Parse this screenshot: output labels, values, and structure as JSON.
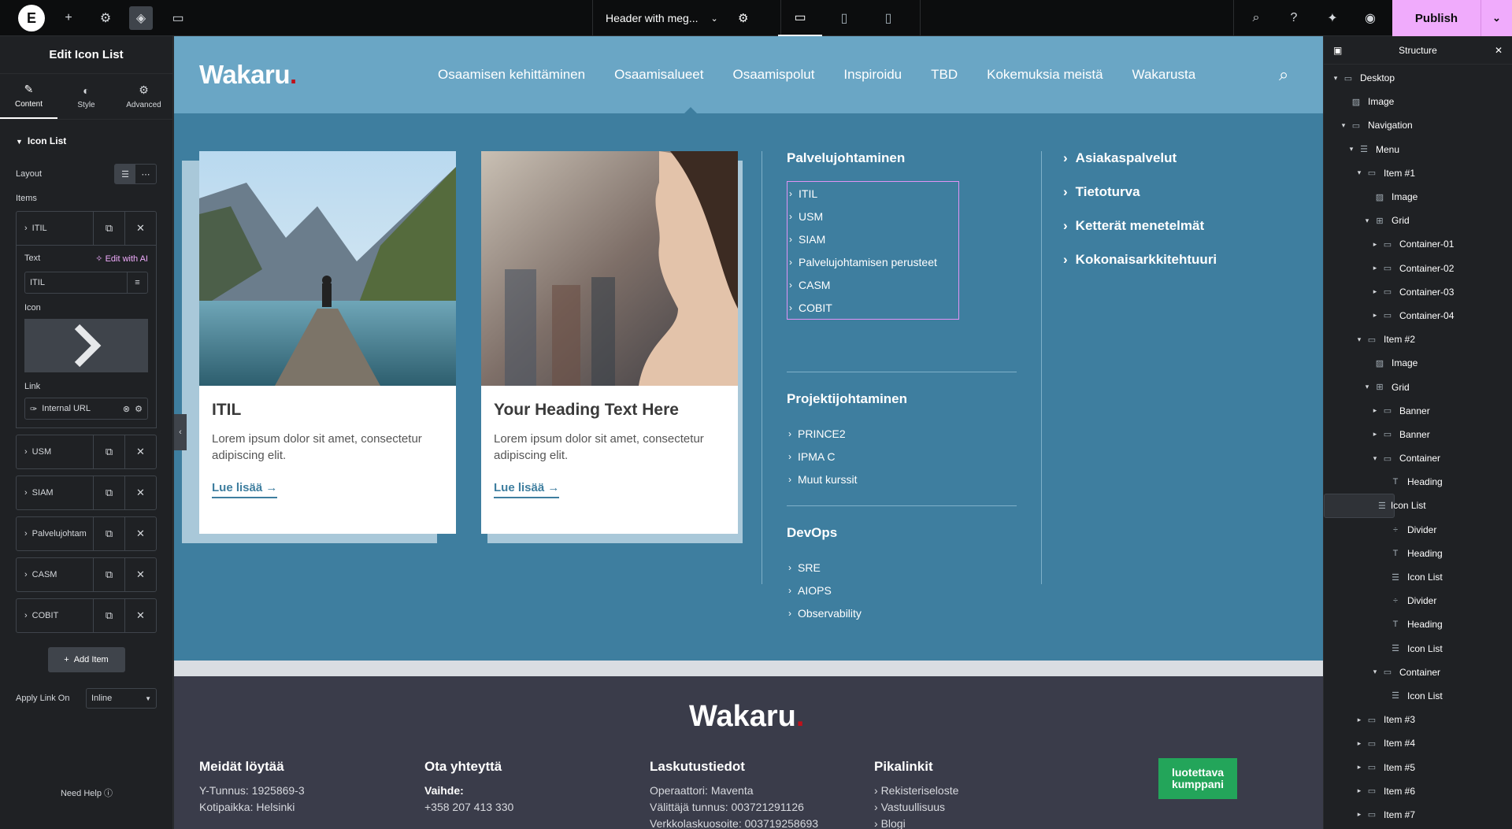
{
  "topbar": {
    "logo": "E",
    "doc_title": "Header with meg...",
    "publish": "Publish"
  },
  "panel": {
    "title": "Edit Icon List",
    "tabs": [
      {
        "label": "Content"
      },
      {
        "label": "Style"
      },
      {
        "label": "Advanced"
      }
    ],
    "section": "Icon List",
    "layout_label": "Layout",
    "items_label": "Items",
    "open_item": {
      "title": "ITIL",
      "text_label": "Text",
      "edit_ai": "Edit with AI",
      "text_value": "ITIL",
      "icon_label": "Icon",
      "link_label": "Link",
      "link_value": "Internal URL"
    },
    "items": [
      "USM",
      "SIAM",
      "Palvelujohtam",
      "CASM",
      "COBIT"
    ],
    "add_item": "Add Item",
    "apply_link_label": "Apply Link On",
    "apply_link_value": "Inline",
    "need_help": "Need Help"
  },
  "site": {
    "logo": "Wakaru",
    "nav": [
      "Osaamisen kehittäminen",
      "Osaamisalueet",
      "Osaamispolut",
      "Inspiroidu",
      "TBD",
      "Kokemuksia meistä",
      "Wakarusta"
    ],
    "cards": [
      {
        "title": "ITIL",
        "body": "Lorem ipsum dolor sit amet, consectetur adipiscing elit.",
        "link": "Lue lisää →"
      },
      {
        "title": "Your Heading Text Here",
        "body": "Lorem ipsum dolor sit amet, consectetur adipiscing elit.",
        "link": "Lue lisää →"
      }
    ],
    "col1": {
      "h1": "Palvelujohtaminen",
      "list1": [
        "ITIL",
        "USM",
        "SIAM",
        "Palvelujohtamisen perusteet",
        "CASM",
        "COBIT"
      ],
      "h2": "Projektijohtaminen",
      "list2": [
        "PRINCE2",
        "IPMA C",
        "Muut kurssit"
      ],
      "h3": "DevOps",
      "list3": [
        "SRE",
        "AIOPS",
        "Observability"
      ]
    },
    "col2": [
      "Asiakaspalvelut",
      "Tietoturva",
      "Ketterät menetelmät",
      "Kokonaisarkkitehtuuri"
    ],
    "footer": {
      "logo": "Wakaru",
      "c1": {
        "h": "Meidät löytää",
        "l1": "Y-Tunnus: 1925869-3",
        "l2": "Kotipaikka: Helsinki"
      },
      "c2": {
        "h": "Ota yhteyttä",
        "l1": "Vaihde:",
        "l2": "+358 207 413 330"
      },
      "c3": {
        "h": "Laskutustiedot",
        "l1": "Operaattori: Maventa",
        "l2": "Välittäjä tunnus: 003721291126",
        "l3": "Verkkolaskuosoite: 003719258693"
      },
      "c4": {
        "h": "Pikalinkit",
        "l1": "Rekisteriseloste",
        "l2": "Vastuullisuus",
        "l3": "Blogi"
      },
      "badge1": "luotettava",
      "badge2": "kumppani"
    }
  },
  "structure": {
    "title": "Structure",
    "items": [
      {
        "label": "Desktop",
        "indent": 0,
        "caret": "▾",
        "icon": "▭"
      },
      {
        "label": "Image",
        "indent": 1,
        "caret": "",
        "icon": "▨"
      },
      {
        "label": "Navigation",
        "indent": 1,
        "caret": "▾",
        "icon": "▭"
      },
      {
        "label": "Menu",
        "indent": 2,
        "caret": "▾",
        "icon": "☰"
      },
      {
        "label": "Item #1",
        "indent": 3,
        "caret": "▾",
        "icon": "▭"
      },
      {
        "label": "Image",
        "indent": 4,
        "caret": "",
        "icon": "▨"
      },
      {
        "label": "Grid",
        "indent": 4,
        "caret": "▾",
        "icon": "⊞"
      },
      {
        "label": "Container-01",
        "indent": 5,
        "caret": "▸",
        "icon": "▭"
      },
      {
        "label": "Container-02",
        "indent": 5,
        "caret": "▸",
        "icon": "▭"
      },
      {
        "label": "Container-03",
        "indent": 5,
        "caret": "▸",
        "icon": "▭"
      },
      {
        "label": "Container-04",
        "indent": 5,
        "caret": "▸",
        "icon": "▭"
      },
      {
        "label": "Item #2",
        "indent": 3,
        "caret": "▾",
        "icon": "▭"
      },
      {
        "label": "Image",
        "indent": 4,
        "caret": "",
        "icon": "▨"
      },
      {
        "label": "Grid",
        "indent": 4,
        "caret": "▾",
        "icon": "⊞"
      },
      {
        "label": "Banner",
        "indent": 5,
        "caret": "▸",
        "icon": "▭"
      },
      {
        "label": "Banner",
        "indent": 5,
        "caret": "▸",
        "icon": "▭"
      },
      {
        "label": "Container",
        "indent": 5,
        "caret": "▾",
        "icon": "▭"
      },
      {
        "label": "Heading",
        "indent": 6,
        "caret": "",
        "icon": "T"
      },
      {
        "label": "Icon List",
        "indent": 6,
        "caret": "",
        "icon": "☰",
        "selected": true
      },
      {
        "label": "Divider",
        "indent": 6,
        "caret": "",
        "icon": "÷"
      },
      {
        "label": "Heading",
        "indent": 6,
        "caret": "",
        "icon": "T"
      },
      {
        "label": "Icon List",
        "indent": 6,
        "caret": "",
        "icon": "☰"
      },
      {
        "label": "Divider",
        "indent": 6,
        "caret": "",
        "icon": "÷"
      },
      {
        "label": "Heading",
        "indent": 6,
        "caret": "",
        "icon": "T"
      },
      {
        "label": "Icon List",
        "indent": 6,
        "caret": "",
        "icon": "☰"
      },
      {
        "label": "Container",
        "indent": 5,
        "caret": "▾",
        "icon": "▭"
      },
      {
        "label": "Icon List",
        "indent": 6,
        "caret": "",
        "icon": "☰"
      },
      {
        "label": "Item #3",
        "indent": 3,
        "caret": "▸",
        "icon": "▭"
      },
      {
        "label": "Item #4",
        "indent": 3,
        "caret": "▸",
        "icon": "▭"
      },
      {
        "label": "Item #5",
        "indent": 3,
        "caret": "▸",
        "icon": "▭"
      },
      {
        "label": "Item #6",
        "indent": 3,
        "caret": "▸",
        "icon": "▭"
      },
      {
        "label": "Item #7",
        "indent": 3,
        "caret": "▸",
        "icon": "▭"
      }
    ]
  }
}
